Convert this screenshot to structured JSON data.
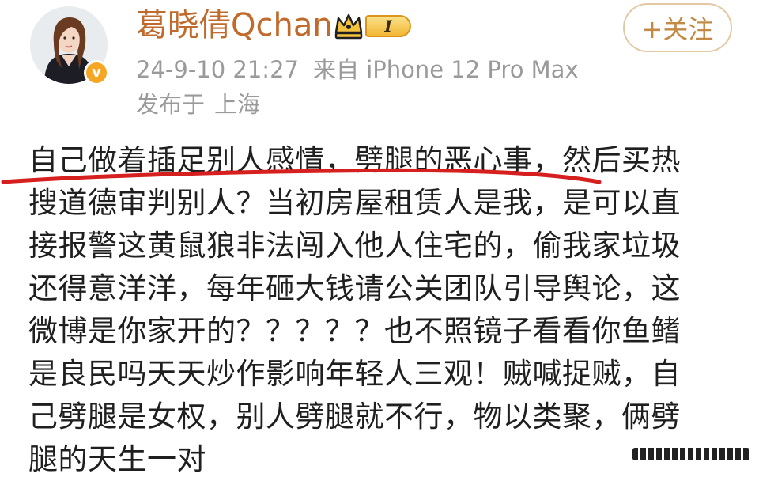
{
  "post_header": {
    "username": "葛晓倩Qchan",
    "level_label": "I",
    "timestamp": "24-9-10 21:27",
    "source": "来自 iPhone 12 Pro Max",
    "location_prefix": "发布于",
    "location": "上海",
    "follow_label": "+关注",
    "avatar_icon": "avatar",
    "verified_icon": "verified-badge-icon",
    "crown_icon": "crown-icon"
  },
  "post_body": {
    "lines": [
      "自己做着插足别人感情，劈腿的恶心事，然后买热",
      "搜道德审判别人？当初房屋租赁人是我，是可以直",
      "接报警这黄鼠狼非法闯入他人住宅的，偷我家垃圾",
      "还得意洋洋，每年砸大钱请公关团队引导舆论，这",
      "微博是你家开的？？？？？也不照镜子看看你鱼鳍",
      "是良民吗天天炒作影响年轻人三观！贼喊捉贼，自",
      "己劈腿是女权，别人劈腿就不行，物以类聚，俩劈",
      "腿的天生一对"
    ]
  },
  "colors": {
    "username": "#c06a2b",
    "meta": "#9a9a9a",
    "follow": "#c28a45",
    "underline": "#d61f1f",
    "badge": "#f5a623"
  }
}
